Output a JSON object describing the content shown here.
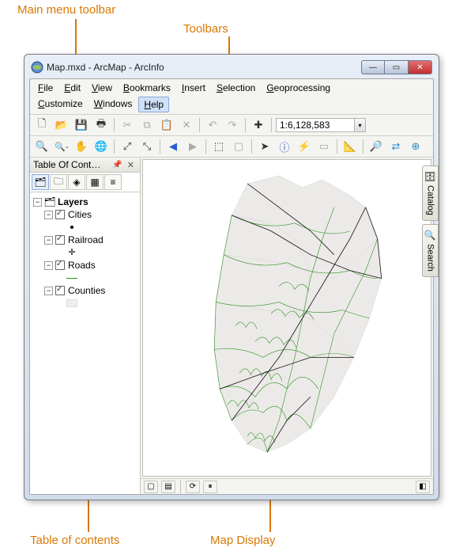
{
  "annotations": {
    "menu": "Main menu toolbar",
    "toolbars": "Toolbars",
    "toc": "Table of contents",
    "map": "Map Display"
  },
  "window": {
    "title": "Map.mxd - ArcMap - ArcInfo"
  },
  "menu": {
    "file": "File",
    "edit": "Edit",
    "view": "View",
    "bookmarks": "Bookmarks",
    "insert": "Insert",
    "selection": "Selection",
    "geoprocessing": "Geoprocessing",
    "customize": "Customize",
    "windows": "Windows",
    "help": "Help"
  },
  "toolbar": {
    "scale": "1:6,128,583"
  },
  "toc": {
    "title": "Table Of Cont…",
    "root": "Layers",
    "layers": [
      {
        "name": "Cities",
        "symbol": "dot"
      },
      {
        "name": "Railroad",
        "symbol": "cross"
      },
      {
        "name": "Roads",
        "symbol": "line"
      },
      {
        "name": "Counties",
        "symbol": "poly"
      }
    ]
  },
  "sidetabs": {
    "catalog": "Catalog",
    "search": "Search"
  }
}
